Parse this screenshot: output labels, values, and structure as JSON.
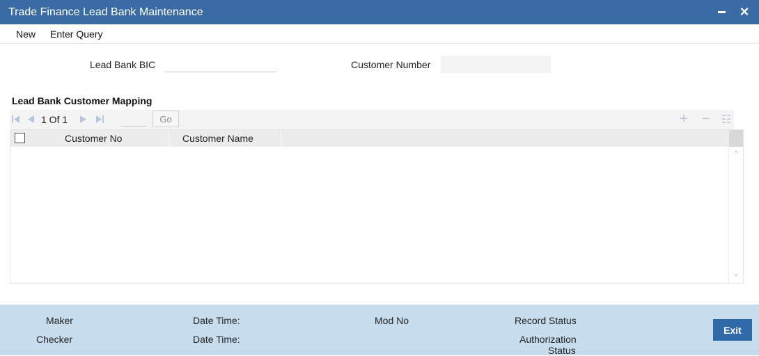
{
  "window": {
    "title": "Trade Finance Lead Bank Maintenance",
    "close_glyph": "×"
  },
  "menu": {
    "new_label": "New",
    "enter_query_label": "Enter Query"
  },
  "form": {
    "lead_bank_bic_label": "Lead Bank BIC",
    "lead_bank_bic_value": "",
    "customer_number_label": "Customer Number",
    "customer_number_value": ""
  },
  "section": {
    "title": "Lead Bank Customer Mapping"
  },
  "pagination": {
    "page_text": "1 Of 1",
    "page_input_value": "",
    "go_label": "Go"
  },
  "grid_actions": {
    "add_glyph": "+",
    "remove_glyph": "−",
    "view_glyph": "☷"
  },
  "grid": {
    "columns": [
      "Customer No",
      "Customer Name"
    ],
    "rows": [],
    "scroll_up_glyph": "⌃",
    "scroll_down_glyph": "⌄"
  },
  "footer": {
    "maker_label": "Maker",
    "checker_label": "Checker",
    "date_time_label_1": "Date Time:",
    "date_time_label_2": "Date Time:",
    "mod_no_label": "Mod No",
    "record_status_label": "Record Status",
    "authorization_status_line1": "Authorization",
    "authorization_status_line2": "Status",
    "exit_label": "Exit"
  },
  "colors": {
    "titlebar": "#3a6ba5",
    "footer": "#c7dced",
    "exit_button": "#2f6aa8",
    "grid_header": "#ececec"
  },
  "icons": {
    "first_page": "first-page-icon",
    "previous_page": "previous-page-icon",
    "next_page": "next-page-icon",
    "last_page": "last-page-icon",
    "add_row": "plus-icon",
    "delete_row": "minus-icon",
    "single_view": "list-view-icon",
    "minimize": "minimize-icon",
    "close": "close-icon"
  }
}
